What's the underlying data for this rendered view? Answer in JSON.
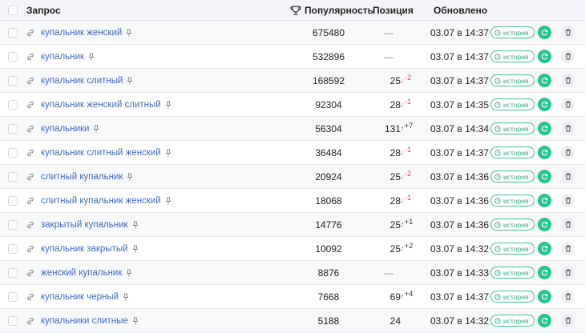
{
  "header": {
    "query": "Запрос",
    "popularity": "Популярность",
    "sort_arrow": "↓",
    "position": "Позиция",
    "updated": "Обновлено"
  },
  "history_label": "история",
  "icons": {
    "link": "link-icon",
    "pin": "pin-icon",
    "trophy": "trophy-icon",
    "history": "clock-icon",
    "refresh": "refresh-icon",
    "delete": "trash-icon"
  },
  "colors": {
    "link_text": "#3d6bc4",
    "accent_green": "#28c48d",
    "negative": "#e04a4a"
  },
  "rows": [
    {
      "query": "купальник женский",
      "popularity": "675480",
      "position": "—",
      "change": "",
      "change_dir": "",
      "updated": "03.07 в 14:37"
    },
    {
      "query": "купальник",
      "popularity": "532896",
      "position": "—",
      "change": "",
      "change_dir": "",
      "updated": "03.07 в 14:37"
    },
    {
      "query": "купальник слитный",
      "popularity": "168592",
      "position": "25",
      "change": "-2",
      "change_dir": "down",
      "updated": "03.07 в 14:37"
    },
    {
      "query": "купальник женский слитный",
      "popularity": "92304",
      "position": "28",
      "change": "-1",
      "change_dir": "down",
      "updated": "03.07 в 14:35"
    },
    {
      "query": "купальники",
      "popularity": "56304",
      "position": "131",
      "change": "+7",
      "change_dir": "up",
      "updated": "03.07 в 14:34"
    },
    {
      "query": "купальник слитный женский",
      "popularity": "36484",
      "position": "28",
      "change": "-1",
      "change_dir": "down",
      "updated": "03.07 в 14:37"
    },
    {
      "query": "слитный купальник",
      "popularity": "20924",
      "position": "25",
      "change": "-2",
      "change_dir": "down",
      "updated": "03.07 в 14:36"
    },
    {
      "query": "слитный купальник женский",
      "popularity": "18068",
      "position": "28",
      "change": "-1",
      "change_dir": "down",
      "updated": "03.07 в 14:36"
    },
    {
      "query": "закрытый купальник",
      "popularity": "14776",
      "position": "25",
      "change": "+1",
      "change_dir": "up",
      "updated": "03.07 в 14:36"
    },
    {
      "query": "купальник закрытый",
      "popularity": "10092",
      "position": "25",
      "change": "+2",
      "change_dir": "up",
      "updated": "03.07 в 14:32"
    },
    {
      "query": "женский купальник",
      "popularity": "8876",
      "position": "—",
      "change": "",
      "change_dir": "",
      "updated": "03.07 в 14:33"
    },
    {
      "query": "купальник черный",
      "popularity": "7668",
      "position": "69",
      "change": "+4",
      "change_dir": "up",
      "updated": "03.07 в 14:37"
    },
    {
      "query": "купальники слитные",
      "popularity": "5188",
      "position": "24",
      "change": "",
      "change_dir": "",
      "updated": "03.07 в 14:32"
    }
  ]
}
